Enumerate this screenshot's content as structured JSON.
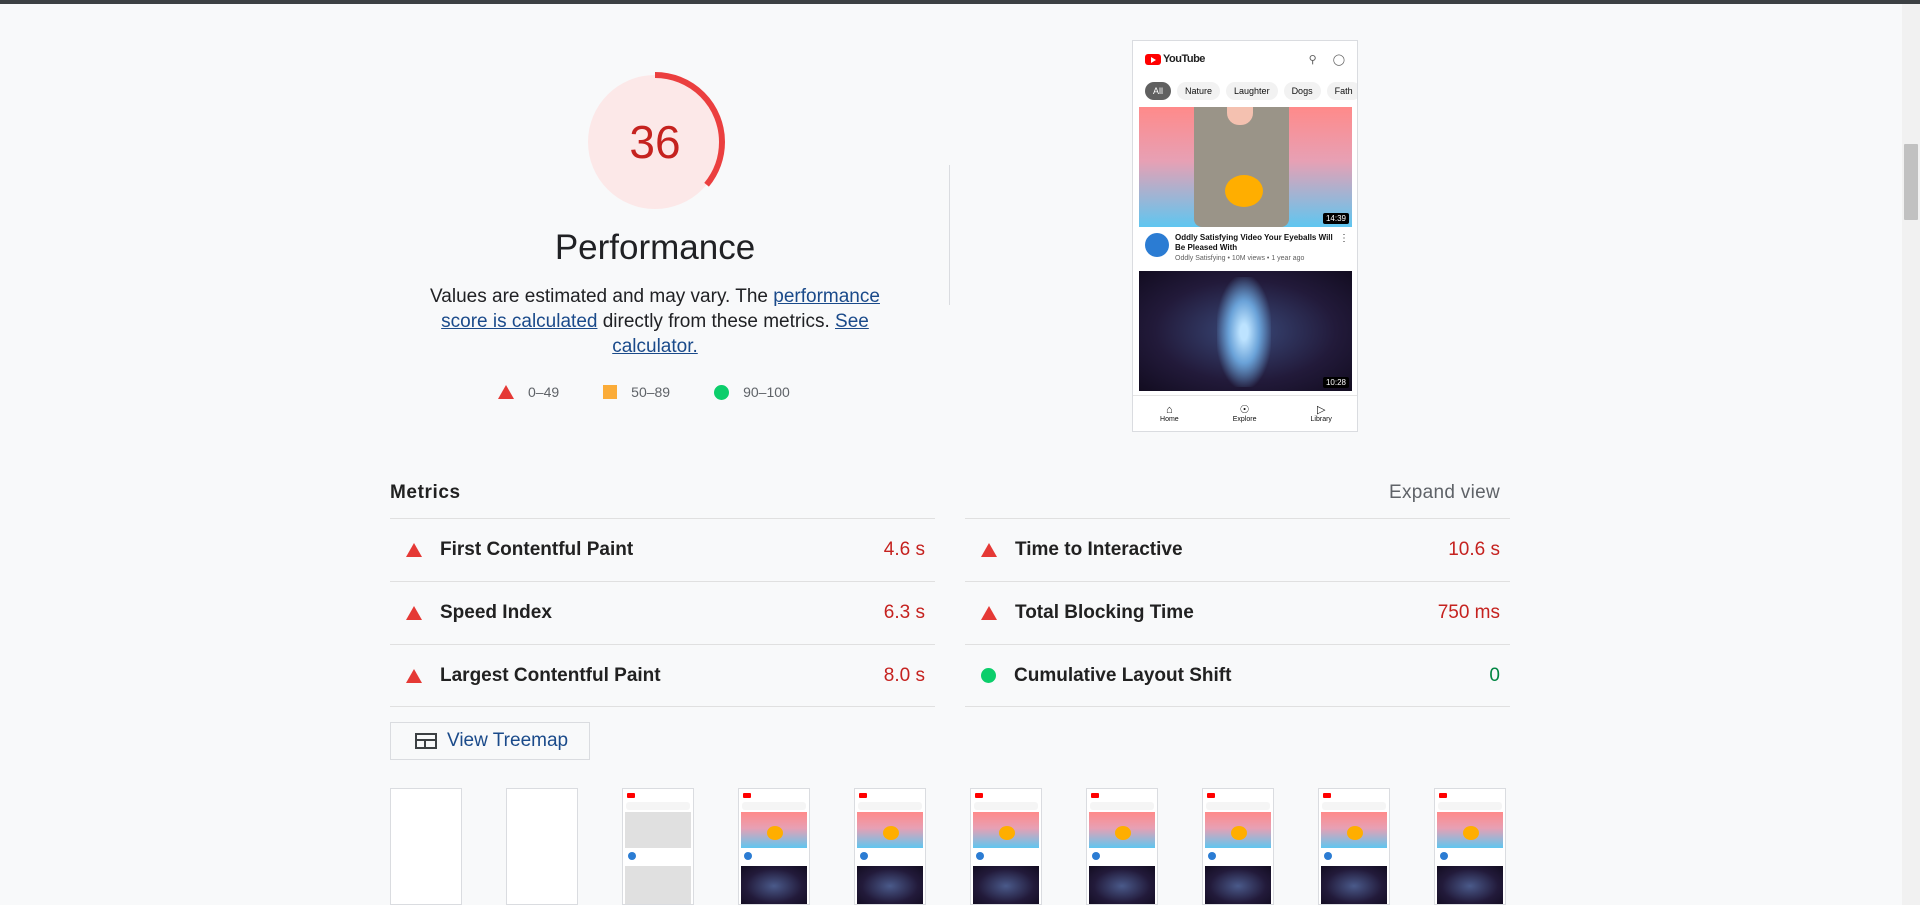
{
  "performance": {
    "score": "36",
    "score_fraction": 0.36,
    "title": "Performance",
    "desc_prefix": "Values are estimated and may vary. The ",
    "desc_link1": "performance score is calculated",
    "desc_middle": " directly from these metrics. ",
    "desc_link2": "See calculator.",
    "legend": [
      {
        "range": "0–49",
        "shape": "triangle",
        "color": "#e53935"
      },
      {
        "range": "50–89",
        "shape": "square",
        "color": "#fbac38"
      },
      {
        "range": "90–100",
        "shape": "circle",
        "color": "#0cce6b"
      }
    ]
  },
  "screenshot": {
    "app_name": "YouTube",
    "chips": [
      "All",
      "Nature",
      "Laughter",
      "Dogs",
      "Fath"
    ],
    "video1": {
      "duration": "14:39",
      "title": "Oddly Satisfying Video Your Eyeballs Will Be Pleased With",
      "meta": "Oddly Satisfying • 10M views • 1 year ago"
    },
    "video2": {
      "duration": "10:28"
    },
    "nav": [
      "Home",
      "Explore",
      "Library"
    ]
  },
  "metrics": {
    "title": "Metrics",
    "expand_label": "Expand view",
    "items": [
      {
        "name": "First Contentful Paint",
        "value": "4.6 s",
        "status": "fail"
      },
      {
        "name": "Time to Interactive",
        "value": "10.6 s",
        "status": "fail"
      },
      {
        "name": "Speed Index",
        "value": "6.3 s",
        "status": "fail"
      },
      {
        "name": "Total Blocking Time",
        "value": "750 ms",
        "status": "fail"
      },
      {
        "name": "Largest Contentful Paint",
        "value": "8.0 s",
        "status": "fail"
      },
      {
        "name": "Cumulative Layout Shift",
        "value": "0",
        "status": "pass"
      }
    ],
    "treemap_label": "View Treemap"
  },
  "colors": {
    "fail": "#c5221f",
    "pass": "#018642",
    "gauge_arc": "#eb3f3f",
    "gauge_bg": "#fce8e8"
  }
}
